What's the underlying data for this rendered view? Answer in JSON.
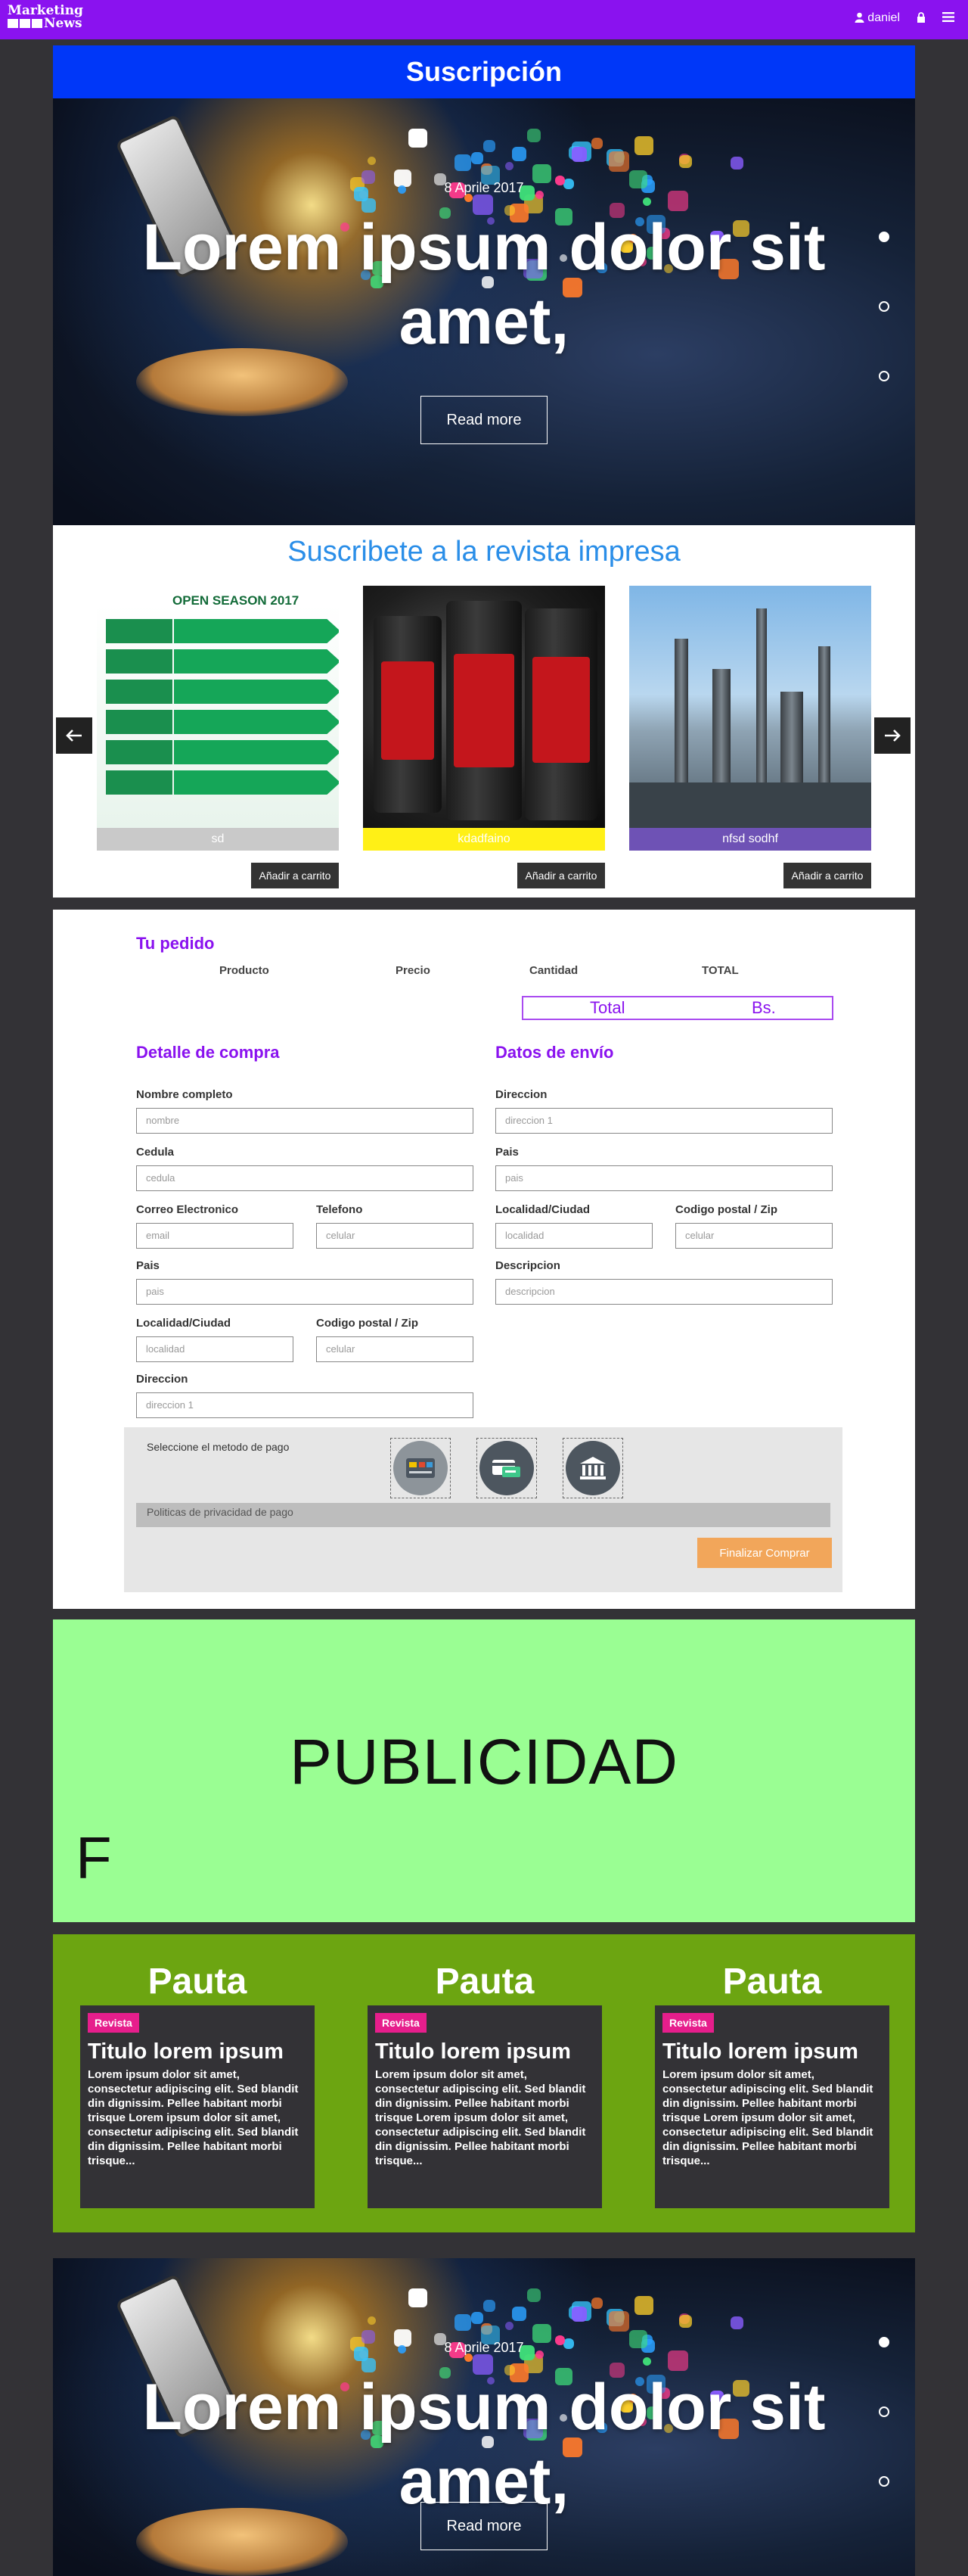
{
  "navbar": {
    "logo_line1": "Marketing",
    "logo_line2": "News",
    "user": "daniel",
    "user_icon": "user-icon",
    "lock_icon": "lock-icon",
    "menu_icon": "hamburger-menu-icon"
  },
  "subscription": {
    "title": "Suscripción"
  },
  "hero": {
    "date": "8 Aprile 2017",
    "title": "Lorem ipsum dolor sit amet,",
    "button": "Read more"
  },
  "magazine": {
    "title": "Suscribete a la revista impresa",
    "prev_icon": "arrow-left-icon",
    "next_icon": "arrow-right-icon",
    "schedule_header": "OPEN SEASON 2017",
    "products": [
      {
        "caption": "sd",
        "caption_color": "#c9c9c9",
        "cart": "Añadir a carrito"
      },
      {
        "caption": "kdadfaino",
        "caption_color": "#fff016",
        "cart": "Añadir a carrito"
      },
      {
        "caption": "nfsd sodhf",
        "caption_color": "#6e52b5",
        "cart": "Añadir a carrito"
      }
    ]
  },
  "order": {
    "title": "Tu pedido",
    "columns": [
      "Producto",
      "Precio",
      "Cantidad",
      "TOTAL"
    ],
    "total_label": "Total",
    "total_currency": "Bs.",
    "billing_title": "Detalle de compra",
    "shipping_title": "Datos de envío",
    "billing": {
      "name_label": "Nombre completo",
      "name_placeholder": "nombre",
      "id_label": "Cedula",
      "id_placeholder": "cedula",
      "email_label": "Correo Electronico",
      "email_placeholder": "email",
      "phone_label": "Telefono",
      "phone_placeholder": "celular",
      "country_label": "Pais",
      "country_placeholder": "pais",
      "city_label": "Localidad/Ciudad",
      "city_placeholder": "localidad",
      "zip_label": "Codigo postal / Zip",
      "zip_placeholder": "celular",
      "address_label": "Direccion",
      "address_placeholder": "direccion 1"
    },
    "shipping": {
      "address_label": "Direccion",
      "address_placeholder": "direccion 1",
      "country_label": "Pais",
      "country_placeholder": "pais",
      "city_label": "Localidad/Ciudad",
      "city_placeholder": "localidad",
      "zip_label": "Codigo postal / Zip",
      "zip_placeholder": "celular",
      "desc_label": "Descripcion",
      "desc_placeholder": "descripcion"
    },
    "payment_label": "Seleccione el metodo de pago",
    "payment_methods": [
      "card-payment-icon",
      "bank-transfer-icon",
      "bank-building-icon"
    ],
    "privacy": "Politicas de privacidad de pago",
    "submit": "Finalizar Comprar"
  },
  "ad": {
    "text": "PUBLICIDAD",
    "letter": "F"
  },
  "pauta": {
    "items": [
      {
        "heading": "Pauta",
        "tag": "Revista",
        "title": "Titulo lorem ipsum",
        "text": "Lorem ipsum dolor sit amet, consectetur adipiscing elit. Sed blandit din dignissim. Pellee habitant morbi trisque Lorem ipsum dolor sit amet, consectetur adipiscing elit. Sed blandit din dignissim. Pellee habitant morbi trisque..."
      },
      {
        "heading": "Pauta",
        "tag": "Revista",
        "title": "Titulo lorem ipsum",
        "text": "Lorem ipsum dolor sit amet, consectetur adipiscing elit. Sed blandit din dignissim. Pellee habitant morbi trisque Lorem ipsum dolor sit amet, consectetur adipiscing elit. Sed blandit din dignissim. Pellee habitant morbi trisque..."
      },
      {
        "heading": "Pauta",
        "tag": "Revista",
        "title": "Titulo lorem ipsum",
        "text": "Lorem ipsum dolor sit amet, consectetur adipiscing elit. Sed blandit din dignissim. Pellee habitant morbi trisque Lorem ipsum dolor sit amet, consectetur adipiscing elit. Sed blandit din dignissim. Pellee habitant morbi trisque..."
      }
    ]
  },
  "hero2": {
    "date": "8 Aprile 2017",
    "title": "Lorem ipsum dolor sit amet,",
    "button": "Read more"
  },
  "colors": {
    "navbar": "#8a12ef",
    "subscription_header": "#0037f8",
    "accent_purple": "#8a12ef",
    "ad_background": "#9afe93",
    "pauta_background": "#6ca511",
    "tag": "#e61e8c",
    "submit": "#f2a65a"
  }
}
